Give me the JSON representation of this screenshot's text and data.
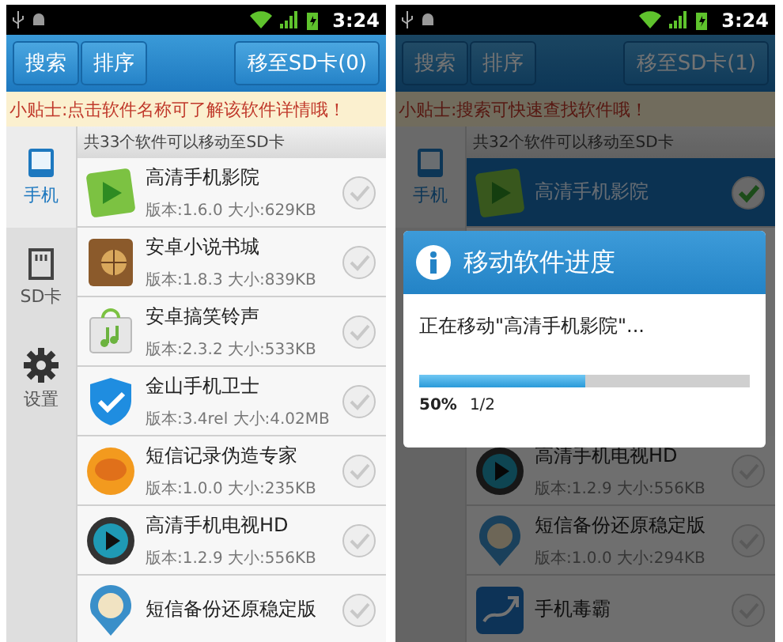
{
  "screens": [
    {
      "status": {
        "time": "3:24"
      },
      "toolbar": {
        "buttons": [
          "搜索",
          "排序"
        ],
        "move_button": "移至SD卡(0)"
      },
      "tip": "小贴士:点击软件名称可了解该软件详情哦！",
      "sidebar": [
        {
          "label": "手机",
          "selected": true
        },
        {
          "label": "SD卡",
          "selected": false
        },
        {
          "label": "设置",
          "selected": false
        }
      ],
      "list_header": "共33个软件可以移动至SD卡",
      "apps": [
        {
          "name": "高清手机影院",
          "info": "版本:1.6.0 大小:629KB",
          "checked": false,
          "selected": false
        },
        {
          "name": "安卓小说书城",
          "info": "版本:1.8.3 大小:839KB",
          "checked": false,
          "selected": false
        },
        {
          "name": "安卓搞笑铃声",
          "info": "版本:2.3.2 大小:533KB",
          "checked": false,
          "selected": false
        },
        {
          "name": "金山手机卫士",
          "info": "版本:3.4rel 大小:4.02MB",
          "checked": false,
          "selected": false
        },
        {
          "name": "短信记录伪造专家",
          "info": "版本:1.0.0 大小:235KB",
          "checked": false,
          "selected": false
        },
        {
          "name": "高清手机电视HD",
          "info": "版本:1.2.9 大小:556KB",
          "checked": false,
          "selected": false
        },
        {
          "name": "短信备份还原稳定版",
          "checked": false,
          "selected": false
        }
      ]
    },
    {
      "status": {
        "time": "3:24"
      },
      "toolbar": {
        "buttons": [
          "搜索",
          "排序"
        ],
        "move_button": "移至SD卡(1)"
      },
      "tip": "小贴士:搜索可快速查找软件哦！",
      "sidebar": [
        {
          "label": "手机",
          "selected": true
        }
      ],
      "list_header": "共32个软件可以移动至SD卡",
      "apps": [
        {
          "name": "高清手机影院",
          "checked": true,
          "selected": true
        },
        {
          "name": "高清手机电视HD",
          "info": "版本:1.2.9 大小:556KB",
          "checked": false,
          "selected": false
        },
        {
          "name": "短信备份还原稳定版",
          "info": "版本:1.0.0 大小:294KB",
          "checked": false,
          "selected": false
        },
        {
          "name": "手机毒霸",
          "checked": false,
          "selected": false
        }
      ],
      "dialog": {
        "title": "移动软件进度",
        "message": "正在移动\"高清手机影院\"...",
        "level": 0.5,
        "percent": "50%",
        "count": "1/2"
      }
    }
  ]
}
